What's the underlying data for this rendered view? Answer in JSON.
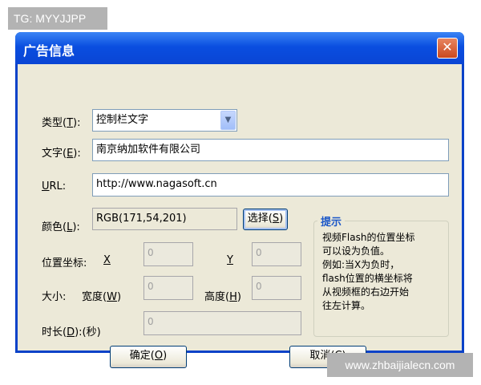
{
  "watermarks": {
    "top": "TG: MYYJJPP",
    "bottom": "www.zhbaijialecn.com"
  },
  "dialog": {
    "title": "广告信息",
    "close_glyph": "✕"
  },
  "form": {
    "type": {
      "label": "类型(",
      "key": "T",
      "label_end": "):",
      "value": "控制栏文字"
    },
    "text": {
      "label": "文字(",
      "key": "E",
      "label_end": "):",
      "value": "南京纳加软件有限公司"
    },
    "url": {
      "key": "U",
      "label_rest": "RL:",
      "value": "http://www.nagasoft.cn"
    },
    "color": {
      "label": "颜色(",
      "key": "L",
      "label_end": "):",
      "value": "RGB(171,54,201)"
    },
    "choose_button": {
      "label": "选择(",
      "key": "S",
      "label_end": ")"
    },
    "position": {
      "label": "位置坐标:",
      "x_label": "X",
      "y_label": "Y",
      "x_value": "0",
      "y_value": "0"
    },
    "size": {
      "label": "大小:",
      "width_label": "宽度(",
      "width_key": "W",
      "width_end": ")",
      "height_label": "高度(",
      "height_key": "H",
      "height_end": ")",
      "width_value": "0",
      "height_value": "0"
    },
    "duration": {
      "label": "时长(",
      "key": "D",
      "label_end": "):(秒)",
      "value": "0"
    }
  },
  "hint": {
    "title": "提示",
    "lines": [
      "视频Flash的位置坐标",
      "可以设为负值。",
      "例如:当X为负时，",
      "flash位置的横坐标将",
      "从视频框的右边开始",
      "往左计算。"
    ]
  },
  "buttons": {
    "ok": {
      "label": "确定(",
      "key": "O",
      "label_end": ")"
    },
    "cancel": {
      "label": "取消(",
      "key": "C",
      "label_end": ")"
    }
  }
}
